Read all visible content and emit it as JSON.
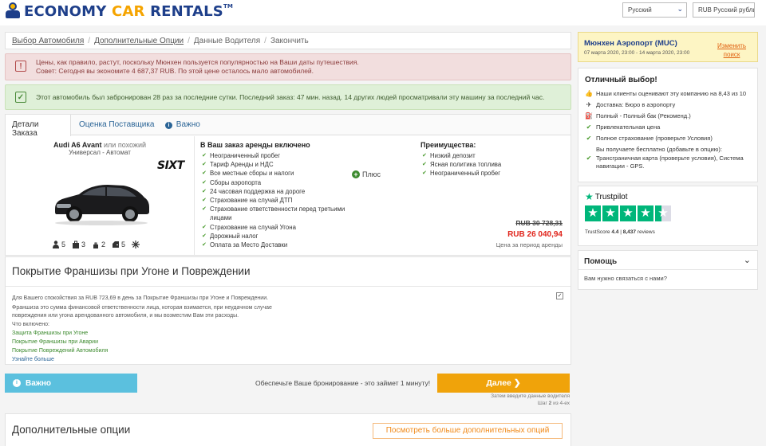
{
  "header": {
    "logo_economy": "ECONOMY",
    "logo_car": "CAR",
    "logo_rentals": "RENTALS",
    "logo_tm": "TM",
    "language": "Русский",
    "currency": "RUB Русский рубль"
  },
  "breadcrumb": {
    "step1": "Выбор Автомобиля",
    "step2": "Дополнительные Опции",
    "step3": "Данные Водителя",
    "step4": "Закончить"
  },
  "alerts": {
    "red_line1": "Цены, как правило, растут, поскольку Мюнхен пользуется популярностью на Ваши даты путешествия.",
    "red_line2": "Совет: Сегодня вы экономите 4 687,37 RUB. По этой цене осталось мало автомобилей.",
    "green": "Этот автомобиль был забронирован 28 раз за последние сутки. Последний заказ: 47 мин. назад. 14 других людей просматривали эту машину за последний час."
  },
  "tabs": {
    "details": "Детали Заказа",
    "rating": "Оценка Поставщика",
    "important": "Важно"
  },
  "car": {
    "name": "Audi A6 Avant",
    "similar": "или похожий",
    "type": "Универсал - Автомат",
    "supplier": "SIXT",
    "seats": "5",
    "large_bags": "3",
    "small_bags": "2",
    "doors": "5"
  },
  "included": {
    "title": "В Ваш заказ аренды включено",
    "items": [
      "Неограниченный пробег",
      "Тариф Аренды и НДС",
      "Все местные сборы и налоги",
      "Сборы аэропорта",
      "24 часовая поддержка на дороге",
      "Страхование на случай ДТП",
      "Страхование ответственности перед третьими лицами",
      "Страхование на случай Угона",
      "Дорожный налог",
      "Оплата за Место Доставки"
    ],
    "plus": "Плюс"
  },
  "advantages": {
    "title": "Преимущества:",
    "items": [
      "Низкий депозит",
      "Ясная политика топлива",
      "Неограниченный пробег"
    ]
  },
  "price": {
    "old": "RUB 30 728,31",
    "new": "RUB 26 040,94",
    "period": "Цена за период аренды"
  },
  "franchise": {
    "title": "Покрытие Франшизы при Угоне и Повреждении",
    "text1": "Для Вашего спокойствия за RUB 723,69 в день за Покрытие Франшизы при Угоне и Повреждении.",
    "text2": "Франшиза это сумма финансовой ответственности лица, которая взимается, при неудачном случае повреждения или угона арендованного автомобиля, и мы возместим Вам эти расходы.",
    "text3": "Что включено:",
    "link1": "Защита Франшизы при Угоне",
    "link2": "Покрытие Франшизы при Аварии",
    "link3": "Покрытие Повреждений Автомобиля",
    "more": "Узнайте больше",
    "checked": "✓"
  },
  "bottom": {
    "important": "Важно",
    "secure": "Обеспечьте Ваше бронирование - это займет 1 минуту!",
    "next": "Далее",
    "hint1": "Затем введите данные водителя",
    "hint2_pre": "Шаг ",
    "hint2_step": "2",
    "hint2_post": " из 4-ех"
  },
  "options": {
    "title": "Дополнительные опции",
    "more_btn": "Посмотреть больше дополнительных опций"
  },
  "location": {
    "title": "Мюнхен Аэропорт (MUC)",
    "dates": "07 марта 2020, 23:00 - 14 марта 2020, 23:00",
    "change": "Изменить поиск"
  },
  "choice": {
    "title": "Отличный выбор!",
    "rows": [
      "Наши клиенты оценивают эту компанию на 8,43 из 10",
      "Доставка: Бюро в аэропорту",
      "Полный - Полный бак (Рекоменд.)",
      "Привлекательная цена",
      "Полное страхование (проверьте Условия)",
      "Вы получаете бесплатно (добавьте в опцию):",
      "Трансграничная карта (проверьте условия), Система навигации - GPS."
    ]
  },
  "trustpilot": {
    "brand": "Trustpilot",
    "score_label": "TrustScore",
    "score": "4.4",
    "reviews": "8,437",
    "reviews_label": "reviews",
    "rating_stars": 4.4
  },
  "help": {
    "title": "Помощь",
    "question": "Вам нужно связаться с нами?"
  },
  "colors": {
    "brand_blue": "#1e3f8a",
    "brand_orange": "#f5a400",
    "next_button": "#f0a30a",
    "info_button": "#5bc0de",
    "price_red": "#e0241b",
    "trustpilot_green": "#00b67a"
  }
}
